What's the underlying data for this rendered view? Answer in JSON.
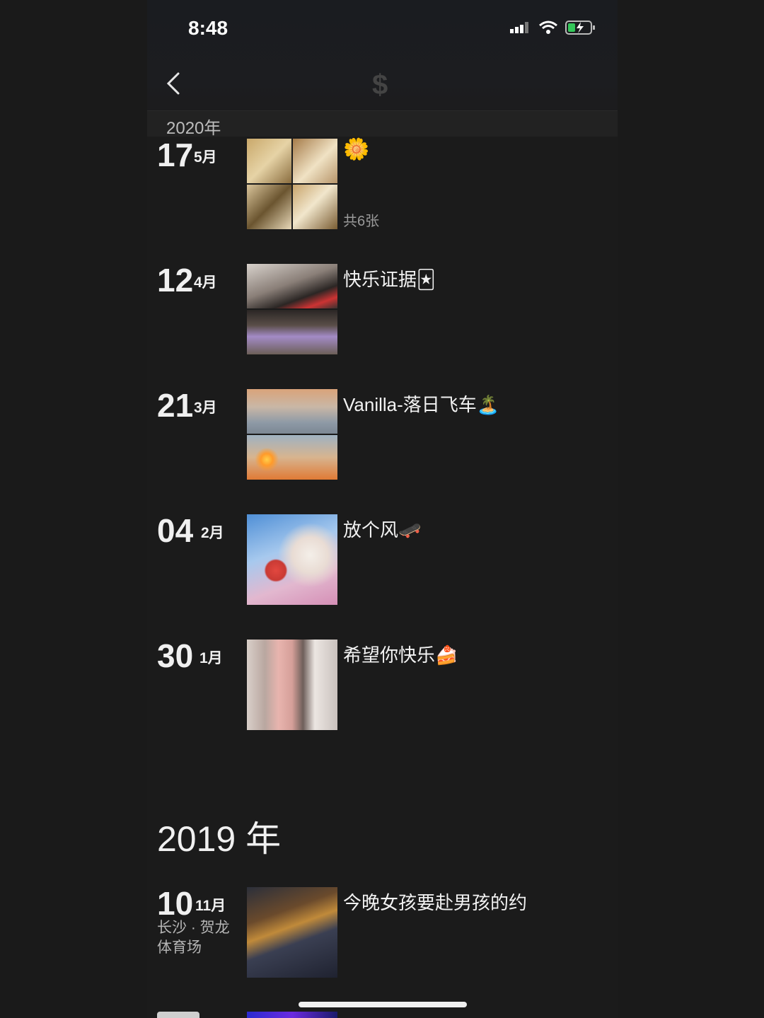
{
  "status_bar": {
    "time": "8:48"
  },
  "header": {
    "logo_icon": "dollar-sign-logo-icon",
    "logo_glyph": "$"
  },
  "sticky_year": "2020年",
  "entries_2020": [
    {
      "day": "17",
      "month": "5月",
      "caption": "🌼",
      "count": "共6张"
    },
    {
      "day": "12",
      "month": "4月",
      "caption": "快乐证据🃏"
    },
    {
      "day": "21",
      "month": "3月",
      "caption": "Vanilla-落日飞车🏝️"
    },
    {
      "day": "04",
      "month": "2月",
      "caption": "放个风🛹"
    },
    {
      "day": "30",
      "month": "1月",
      "caption": "希望你快乐🍰"
    }
  ],
  "year_2019": "2019 年",
  "entries_2019": [
    {
      "day": "10",
      "month": "11月",
      "location_line1": "长沙 · 贺龙",
      "location_line2": "体育场",
      "caption": "今晚女孩要赴男孩的约"
    }
  ],
  "colors": {
    "background": "#1b1b1b",
    "text": "#f0f0f0",
    "muted": "#9a9a9a"
  }
}
